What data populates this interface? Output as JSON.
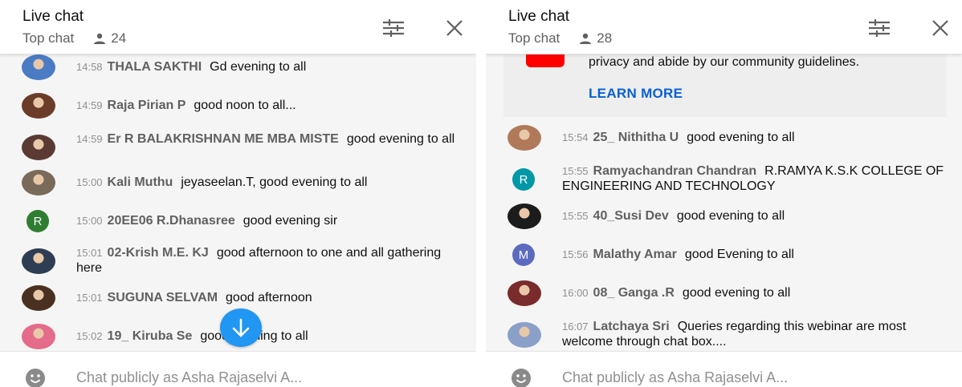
{
  "panels": [
    {
      "title": "Live chat",
      "mode": "Top chat",
      "viewer_count": "24",
      "messages": [
        {
          "time": "14:58",
          "author": "THALA SAKTHI",
          "text": "Gd evening to all",
          "avatar": "photo",
          "color": "#4a7bc4"
        },
        {
          "time": "14:59",
          "author": "Raja Pirian P",
          "text": "good noon to all...",
          "avatar": "photo",
          "color": "#6b3c2a"
        },
        {
          "time": "14:59",
          "author": "Er R BALAKRISHNAN ME MBA MISTE",
          "text": "good evening to all",
          "avatar": "photo",
          "color": "#5a3a32"
        },
        {
          "time": "15:00",
          "author": "Kali Muthu",
          "text": "jeyaseelan.T, good evening to all",
          "avatar": "photo",
          "color": "#7a6a5a"
        },
        {
          "time": "15:00",
          "author": "20EE06 R.Dhanasree",
          "text": "good evening sir",
          "avatar": "letter",
          "letter": "R",
          "color": "#2e7d32"
        },
        {
          "time": "15:01",
          "author": "02-Krish M.E. KJ",
          "text": "good afternoon to one and all gathering here",
          "avatar": "photo",
          "color": "#2f3d52"
        },
        {
          "time": "15:01",
          "author": "SUGUNA SELVAM",
          "text": "good afternoon",
          "avatar": "photo",
          "color": "#4a3020"
        },
        {
          "time": "15:02",
          "author": "19_ Kiruba Se",
          "text": "good evening to all",
          "avatar": "photo",
          "color": "#e56b8a"
        }
      ],
      "input_placeholder": "Chat publicly as Asha Rajaselvi A..."
    },
    {
      "title": "Live chat",
      "mode": "Top chat",
      "viewer_count": "28",
      "notice": {
        "text": "privacy and abide by our community guidelines.",
        "link": "LEARN MORE"
      },
      "messages": [
        {
          "time": "15:54",
          "author": "25_ Nithitha U",
          "text": "good evening to all",
          "avatar": "photo",
          "color": "#b07a5a"
        },
        {
          "time": "15:55",
          "author": "Ramyachandran Chandran",
          "text": "R.RAMYA K.S.K COLLEGE OF ENGINEERING AND TECHNOLOGY",
          "avatar": "letter",
          "letter": "R",
          "color": "#0097a7"
        },
        {
          "time": "15:55",
          "author": "40_Susi Dev",
          "text": "good evening to all",
          "avatar": "photo",
          "color": "#1c1c1c"
        },
        {
          "time": "15:56",
          "author": "Malathy Amar",
          "text": "good Evening to all",
          "avatar": "letter",
          "letter": "M",
          "color": "#5c6bc0"
        },
        {
          "time": "16:00",
          "author": "08_ Ganga .R",
          "text": "good evening to all",
          "avatar": "photo",
          "color": "#7a2b2b"
        },
        {
          "time": "16:07",
          "author": "Latchaya Sri",
          "text": "Queries regarding this webinar are most welcome through chat box....",
          "avatar": "photo",
          "color": "#8aa0c8"
        }
      ],
      "input_placeholder": "Chat publicly as Asha Rajaselvi A..."
    }
  ],
  "icons": {
    "filter": "sliders-icon",
    "close": "close-icon",
    "viewers": "person-icon",
    "scroll": "arrow-down-icon",
    "emoji": "emoji-icon"
  },
  "colors": {
    "accent_blue": "#2196f3",
    "link_blue": "#065fd4",
    "youtube_red": "#ff0000"
  }
}
